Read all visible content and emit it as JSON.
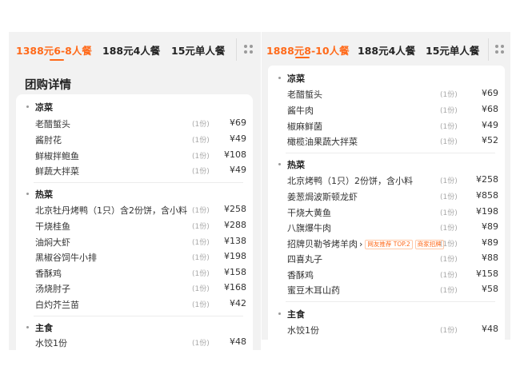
{
  "left": {
    "tabs": [
      {
        "label": "1388元6-8人餐",
        "active": true
      },
      {
        "label": "188元4人餐",
        "active": false
      },
      {
        "label": "15元单人餐",
        "active": false
      }
    ],
    "section_title": "团购详情",
    "categories": [
      {
        "title": "凉菜",
        "items": [
          {
            "name": "老醋蜇头",
            "qty": "(1份)",
            "price": "¥69"
          },
          {
            "name": "酱肘花",
            "qty": "(1份)",
            "price": "¥49"
          },
          {
            "name": "鲜椒拌鲍鱼",
            "qty": "(1份)",
            "price": "¥108"
          },
          {
            "name": "鲜蔬大拌菜",
            "qty": "(1份)",
            "price": "¥49"
          }
        ]
      },
      {
        "title": "热菜",
        "items": [
          {
            "name": "北京牡丹烤鸭（1只）含2份饼，含小料",
            "qty": "(1份)",
            "price": "¥258"
          },
          {
            "name": "干烧桂鱼",
            "qty": "(1份)",
            "price": "¥288"
          },
          {
            "name": "油焖大虾",
            "qty": "(1份)",
            "price": "¥138"
          },
          {
            "name": "黑椒谷饲牛小排",
            "qty": "(1份)",
            "price": "¥198"
          },
          {
            "name": "香酥鸡",
            "qty": "(1份)",
            "price": "¥158"
          },
          {
            "name": "汤烧肘子",
            "qty": "(1份)",
            "price": "¥168"
          },
          {
            "name": "白灼芥兰苗",
            "qty": "(1份)",
            "price": "¥42"
          }
        ]
      },
      {
        "title": "主食",
        "items": [
          {
            "name": "水饺1份",
            "qty": "(1份)",
            "price": "¥48"
          }
        ]
      }
    ]
  },
  "right": {
    "tabs": [
      {
        "label": "1888元8-10人餐",
        "active": true
      },
      {
        "label": "188元4人餐",
        "active": false
      },
      {
        "label": "15元单人餐",
        "active": false
      }
    ],
    "categories": [
      {
        "title": "凉菜",
        "items": [
          {
            "name": "老醋蜇头",
            "qty": "(1份)",
            "price": "¥69"
          },
          {
            "name": "酱牛肉",
            "qty": "(1份)",
            "price": "¥68"
          },
          {
            "name": "椒麻鲜菌",
            "qty": "(1份)",
            "price": "¥49"
          },
          {
            "name": "橄榄油果蔬大拌菜",
            "qty": "(1份)",
            "price": "¥52"
          }
        ]
      },
      {
        "title": "热菜",
        "items": [
          {
            "name": "北京烤鸭（1只）2份饼，含小料",
            "qty": "(1份)",
            "price": "¥258"
          },
          {
            "name": "姜葱焗波斯顿龙虾",
            "qty": "(1份)",
            "price": "¥858"
          },
          {
            "name": "干烧大黄鱼",
            "qty": "(1份)",
            "price": "¥198"
          },
          {
            "name": "八旗爆牛肉",
            "qty": "(1份)",
            "price": "¥89"
          },
          {
            "name": "招牌贝勒爷烤羊肉",
            "arrow": "›",
            "tags": [
              "网友推荐 TOP.2",
              "商家招牌"
            ],
            "qty": "(1份)",
            "price": "¥89"
          },
          {
            "name": "四喜丸子",
            "qty": "(1份)",
            "price": "¥88"
          },
          {
            "name": "香酥鸡",
            "qty": "(1份)",
            "price": "¥158"
          },
          {
            "name": "蜜豆木耳山药",
            "qty": "(1份)",
            "price": "¥58"
          }
        ]
      },
      {
        "title": "主食",
        "items": [
          {
            "name": "水饺1份",
            "qty": "(1份)",
            "price": "¥48"
          }
        ]
      }
    ]
  },
  "colors": {
    "accent": "#ff6a1a",
    "background": "#f2f2f2",
    "card": "#ffffff"
  },
  "icons": {
    "tab_more": "grid-dots-icon"
  }
}
